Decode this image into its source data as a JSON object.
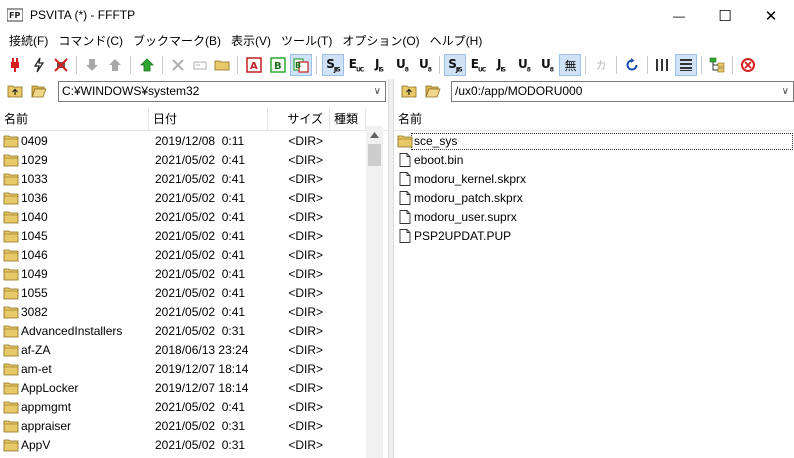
{
  "window": {
    "title": "PSVITA (*) - FFFTP",
    "minimize_glyph": "—",
    "maximize_glyph": "☐",
    "close_glyph": "✕"
  },
  "menu": [
    "接続(F)",
    "コマンド(C)",
    "ブックマーク(B)",
    "表示(V)",
    "ツール(T)",
    "オプション(O)",
    "ヘルプ(H)"
  ],
  "toolbar": {
    "transfer_modes": [
      {
        "main": "S",
        "sub": "JIS"
      },
      {
        "main": "E",
        "sub": "UC"
      },
      {
        "main": "J",
        "sub": "IS"
      },
      {
        "main": "U",
        "sub": "8"
      },
      {
        "main": "U",
        "sub": "8"
      }
    ],
    "kanji_none_label": "無",
    "kana_label": "カ",
    "colors": {
      "pressed_bg": "#cfe2f6",
      "connect_red": "#d42020",
      "green": "#2fa832"
    }
  },
  "local": {
    "path": "C:¥WINDOWS¥system32",
    "columns": [
      "名前",
      "日付",
      "サイズ",
      "種類"
    ],
    "files": [
      {
        "name": "0409",
        "date": "2019/12/08  0:11",
        "size": "<DIR>"
      },
      {
        "name": "1029",
        "date": "2021/05/02  0:41",
        "size": "<DIR>"
      },
      {
        "name": "1033",
        "date": "2021/05/02  0:41",
        "size": "<DIR>"
      },
      {
        "name": "1036",
        "date": "2021/05/02  0:41",
        "size": "<DIR>"
      },
      {
        "name": "1040",
        "date": "2021/05/02  0:41",
        "size": "<DIR>"
      },
      {
        "name": "1045",
        "date": "2021/05/02  0:41",
        "size": "<DIR>"
      },
      {
        "name": "1046",
        "date": "2021/05/02  0:41",
        "size": "<DIR>"
      },
      {
        "name": "1049",
        "date": "2021/05/02  0:41",
        "size": "<DIR>"
      },
      {
        "name": "1055",
        "date": "2021/05/02  0:41",
        "size": "<DIR>"
      },
      {
        "name": "3082",
        "date": "2021/05/02  0:41",
        "size": "<DIR>"
      },
      {
        "name": "AdvancedInstallers",
        "date": "2021/05/02  0:31",
        "size": "<DIR>"
      },
      {
        "name": "af-ZA",
        "date": "2018/06/13 23:24",
        "size": "<DIR>"
      },
      {
        "name": "am-et",
        "date": "2019/12/07 18:14",
        "size": "<DIR>"
      },
      {
        "name": "AppLocker",
        "date": "2019/12/07 18:14",
        "size": "<DIR>"
      },
      {
        "name": "appmgmt",
        "date": "2021/05/02  0:41",
        "size": "<DIR>"
      },
      {
        "name": "appraiser",
        "date": "2021/05/02  0:31",
        "size": "<DIR>"
      },
      {
        "name": "AppV",
        "date": "2021/05/02  0:31",
        "size": "<DIR>"
      }
    ]
  },
  "remote": {
    "path": "/ux0:/app/MODORU000",
    "columns": [
      "名前"
    ],
    "files": [
      {
        "name": "sce_sys",
        "type": "folder"
      },
      {
        "name": "eboot.bin",
        "type": "file"
      },
      {
        "name": "modoru_kernel.skprx",
        "type": "file"
      },
      {
        "name": "modoru_patch.skprx",
        "type": "file"
      },
      {
        "name": "modoru_user.suprx",
        "type": "file"
      },
      {
        "name": "PSP2UPDAT.PUP",
        "type": "file"
      }
    ]
  }
}
